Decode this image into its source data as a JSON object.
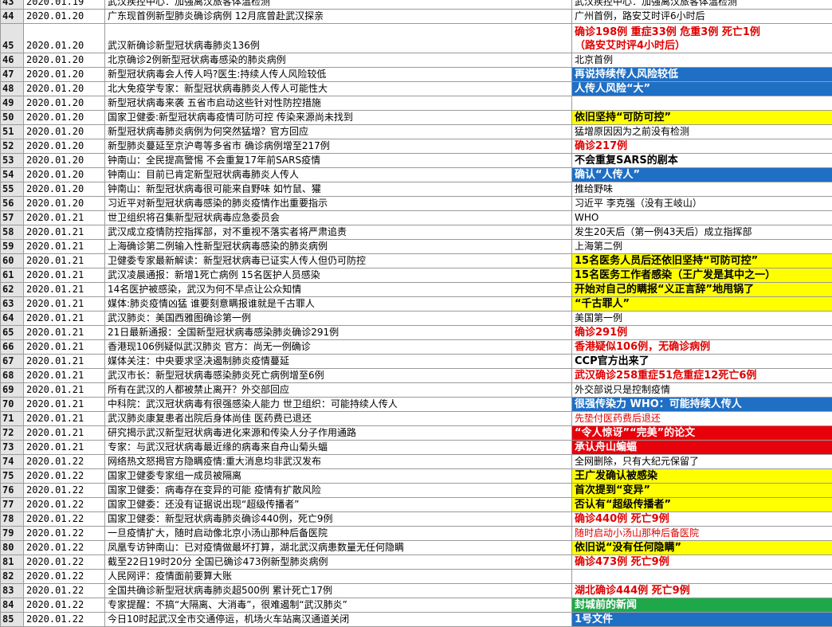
{
  "rows": [
    {
      "n": "43",
      "date": "2020.01.19",
      "title": "武汉疾控中心：加强离汉旅客体温检测",
      "note": "武汉疾控中心：加强离汉旅客体温检测",
      "style": "normal"
    },
    {
      "n": "44",
      "date": "2020.01.20",
      "title": "广东现首例新型肺炎确诊病例 12月底曾赴武汉探亲",
      "note": "广州首例，路安艾时评6小时后",
      "style": "normal"
    },
    {
      "n": "45",
      "date": "2020.01.20",
      "title": "武汉新确诊新型冠状病毒肺炎136例",
      "note": "确诊198例 重症33例 危重3例 死亡1例\n（路安艾时评4小时后）",
      "style": "red-bold",
      "tall": true
    },
    {
      "n": "46",
      "date": "2020.01.20",
      "title": "北京确诊2例新型冠状病毒感染的肺炎病例",
      "note": "北京首例",
      "style": "normal"
    },
    {
      "n": "47",
      "date": "2020.01.20",
      "title": "新型冠状病毒会人传人吗?医生:持续人传人风险较低",
      "note": "再说持续传人风险较低",
      "style": "blue"
    },
    {
      "n": "48",
      "date": "2020.01.20",
      "title": "北大免疫学专家：新型冠状病毒肺炎人传人可能性大",
      "note": "人传人风险“大”",
      "style": "blue"
    },
    {
      "n": "49",
      "date": "2020.01.20",
      "title": "新型冠状病毒来袭 五省市启动这些针对性防控措施",
      "note": "",
      "style": "normal"
    },
    {
      "n": "50",
      "date": "2020.01.20",
      "title": "国家卫健委:新型冠状病毒疫情可防可控  传染来源尚未找到",
      "note": "依旧坚持“可防可控”",
      "style": "yellow"
    },
    {
      "n": "51",
      "date": "2020.01.20",
      "title": "新型冠状病毒肺炎病例为何突然猛增？官方回应",
      "note": "猛增原因因为之前没有检测",
      "style": "normal"
    },
    {
      "n": "52",
      "date": "2020.01.20",
      "title": "新型肺炎蔓延至京沪粤等多省市  确诊病例增至217例",
      "note": "确诊217例",
      "style": "red-bold"
    },
    {
      "n": "53",
      "date": "2020.01.20",
      "title": "钟南山：全民提高警惕 不会重复17年前SARS疫情",
      "note": "不会重复SARS的剧本",
      "style": "bold"
    },
    {
      "n": "54",
      "date": "2020.01.20",
      "title": "钟南山：目前已肯定新型冠状病毒肺炎人传人",
      "note": "确认“人传人”",
      "style": "blue"
    },
    {
      "n": "55",
      "date": "2020.01.20",
      "title": "钟南山：新型冠状病毒很可能来自野味 如竹鼠、獾",
      "note": "推给野味",
      "style": "normal"
    },
    {
      "n": "56",
      "date": "2020.01.20",
      "title": "习近平对新型冠状病毒感染的肺炎疫情作出重要指示",
      "note": "习近平 李克强（没有王岐山）",
      "style": "normal"
    },
    {
      "n": "57",
      "date": "2020.01.21",
      "title": "世卫组织将召集新型冠状病毒应急委员会",
      "note": "WHO",
      "style": "normal"
    },
    {
      "n": "58",
      "date": "2020.01.21",
      "title": "武汉成立疫情防控指挥部，对不重视不落实者将严肃追责",
      "note": "发生20天后（第一例43天后）成立指挥部",
      "style": "normal"
    },
    {
      "n": "59",
      "date": "2020.01.21",
      "title": "上海确诊第二例输入性新型冠状病毒感染的肺炎病例",
      "note": "上海第二例",
      "style": "normal"
    },
    {
      "n": "60",
      "date": "2020.01.21",
      "title": "卫健委专家最新解读：新型冠状病毒已证实人传人但仍可防控",
      "note": "15名医务人员后还依旧坚持“可防可控”",
      "style": "yellow"
    },
    {
      "n": "61",
      "date": "2020.01.21",
      "title": "武汉凌晨通报：新增1死亡病例 15名医护人员感染",
      "note": "15名医务工作者感染（王广发是其中之一）",
      "style": "yellow"
    },
    {
      "n": "62",
      "date": "2020.01.21",
      "title": "14名医护被感染，武汉为何不早点让公众知情",
      "note": "开始对自己的瞒报“义正言辞”地甩锅了",
      "style": "yellow"
    },
    {
      "n": "63",
      "date": "2020.01.21",
      "title": "媒体:肺炎疫情凶猛 谁要刻意瞒报谁就是千古罪人",
      "note": "“千古罪人”",
      "style": "yellow"
    },
    {
      "n": "64",
      "date": "2020.01.21",
      "title": "武汉肺炎：美国西雅图确诊第一例",
      "note": "美国第一例",
      "style": "normal"
    },
    {
      "n": "65",
      "date": "2020.01.21",
      "title": "21日最新通报：全国新型冠状病毒感染肺炎确诊291例",
      "note": "确诊291例",
      "style": "red-bold"
    },
    {
      "n": "66",
      "date": "2020.01.21",
      "title": "香港现106例疑似武汉肺炎 官方：尚无一例确诊",
      "note": "香港疑似106例，无确诊病例",
      "style": "red-bold"
    },
    {
      "n": "67",
      "date": "2020.01.21",
      "title": "媒体关注：中央要求坚决遏制肺炎疫情蔓延",
      "note": "CCP官方出来了",
      "style": "bold"
    },
    {
      "n": "68",
      "date": "2020.01.21",
      "title": "武汉市长：新型冠状病毒感染肺炎死亡病例增至6例",
      "note": "武汉确诊258重症51危重症12死亡6例",
      "style": "red-bold"
    },
    {
      "n": "69",
      "date": "2020.01.21",
      "title": "所有在武汉的人都被禁止离开？外交部回应",
      "note": "外交部说只是控制疫情",
      "style": "normal"
    },
    {
      "n": "70",
      "date": "2020.01.21",
      "title": "中科院：武汉冠状病毒有很强感染人能力 世卫组织：可能持续人传人",
      "note": "很强传染力 WHO：可能持续人传人",
      "style": "blue"
    },
    {
      "n": "71",
      "date": "2020.01.21",
      "title": "武汉肺炎康复患者出院后身体尚佳 医药费已退还",
      "note": "先垫付医药费后退还",
      "style": "red-plain"
    },
    {
      "n": "72",
      "date": "2020.01.21",
      "title": "研究揭示武汉新型冠状病毒进化来源和传染人分子作用通路",
      "note": "“令人惊讶”“完美”的论文",
      "style": "redbg"
    },
    {
      "n": "73",
      "date": "2020.01.21",
      "title": "专家：与武汉冠状病毒最近缘的病毒来自舟山菊头蝠",
      "note": "承认舟山蝙蝠",
      "style": "redbg"
    },
    {
      "n": "74",
      "date": "2020.01.22",
      "title": "网络热文怒揭官方隐瞒疫情:重大消息均非武汉发布",
      "note": "全网删除，只有大纪元保留了",
      "style": "normal"
    },
    {
      "n": "75",
      "date": "2020.01.22",
      "title": "国家卫健委专家组一成员被隔离",
      "note": "王广发确认被感染",
      "style": "yellow"
    },
    {
      "n": "76",
      "date": "2020.01.22",
      "title": "国家卫健委：病毒存在变异的可能 疫情有扩散风险",
      "note": "首次提到“变异”",
      "style": "yellow"
    },
    {
      "n": "77",
      "date": "2020.01.22",
      "title": "国家卫健委：还没有证据说出现“超级传播者”",
      "note": "否认有“超级传播者”",
      "style": "yellow"
    },
    {
      "n": "78",
      "date": "2020.01.22",
      "title": "国家卫健委：新型冠状病毒肺炎确诊440例，死亡9例",
      "note": "确诊440例 死亡9例",
      "style": "red-bold"
    },
    {
      "n": "79",
      "date": "2020.01.22",
      "title": "一旦疫情扩大，随时启动像北京小汤山那种后备医院",
      "note": "随时启动小汤山那种后备医院",
      "style": "red-plain"
    },
    {
      "n": "80",
      "date": "2020.01.22",
      "title": "凤凰专访钟南山：已对疫情做最坏打算，湖北武汉病患数量无任何隐瞒",
      "note": "依旧说“没有任何隐瞒”",
      "style": "yellow"
    },
    {
      "n": "81",
      "date": "2020.01.22",
      "title": "截至22日19时20分 全国已确诊473例新型肺炎病例",
      "note": "确诊473例 死亡9例",
      "style": "red-bold"
    },
    {
      "n": "82",
      "date": "2020.01.22",
      "title": "人民网评：疫情面前要算大账",
      "note": "",
      "style": "normal"
    },
    {
      "n": "83",
      "date": "2020.01.22",
      "title": "全国共确诊新型冠状病毒肺炎超500例 累计死亡17例",
      "note": "湖北确诊444例 死亡9例",
      "style": "red-bold"
    },
    {
      "n": "84",
      "date": "2020.01.22",
      "title": "专家提醒：不搞“大隔离、大消毒”，很难遏制“武汉肺炎”",
      "note": "封城前的新闻",
      "style": "green"
    },
    {
      "n": "85",
      "date": "2020.01.22",
      "title": "今日10时起武汉全市交通停运，机场火车站离汉通道关闭",
      "note": "1号文件",
      "style": "blue"
    }
  ],
  "colors": {
    "blue": "#1f6fc5",
    "yellow": "#ffff00",
    "red": "#e8000b",
    "green": "#1fa84a",
    "redtext": "#e00000"
  }
}
